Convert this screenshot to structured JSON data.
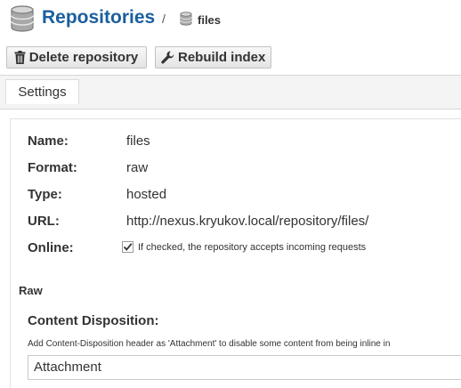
{
  "breadcrumb": {
    "title": "Repositories",
    "separator": "/",
    "current": "files",
    "icon": "database-icon"
  },
  "toolbar": {
    "delete_label": "Delete repository",
    "delete_icon": "trash-icon",
    "rebuild_label": "Rebuild index",
    "rebuild_icon": "wrench-icon"
  },
  "tabs": [
    {
      "label": "Settings",
      "active": true
    }
  ],
  "details": {
    "name_label": "Name:",
    "name_value": "files",
    "format_label": "Format:",
    "format_value": "raw",
    "type_label": "Type:",
    "type_value": "hosted",
    "url_label": "URL:",
    "url_value": "http://nexus.kryukov.local/repository/files/",
    "online_label": "Online:",
    "online_checked": true,
    "online_help": "If checked, the repository accepts incoming requests"
  },
  "raw": {
    "section_title": "Raw",
    "field_title": "Content Disposition:",
    "help_text": "Add Content-Disposition header as 'Attachment' to disable some content from being inline in",
    "selected": "Attachment"
  },
  "colors": {
    "title": "#1a5f9e",
    "database": "#8a8a8a"
  }
}
